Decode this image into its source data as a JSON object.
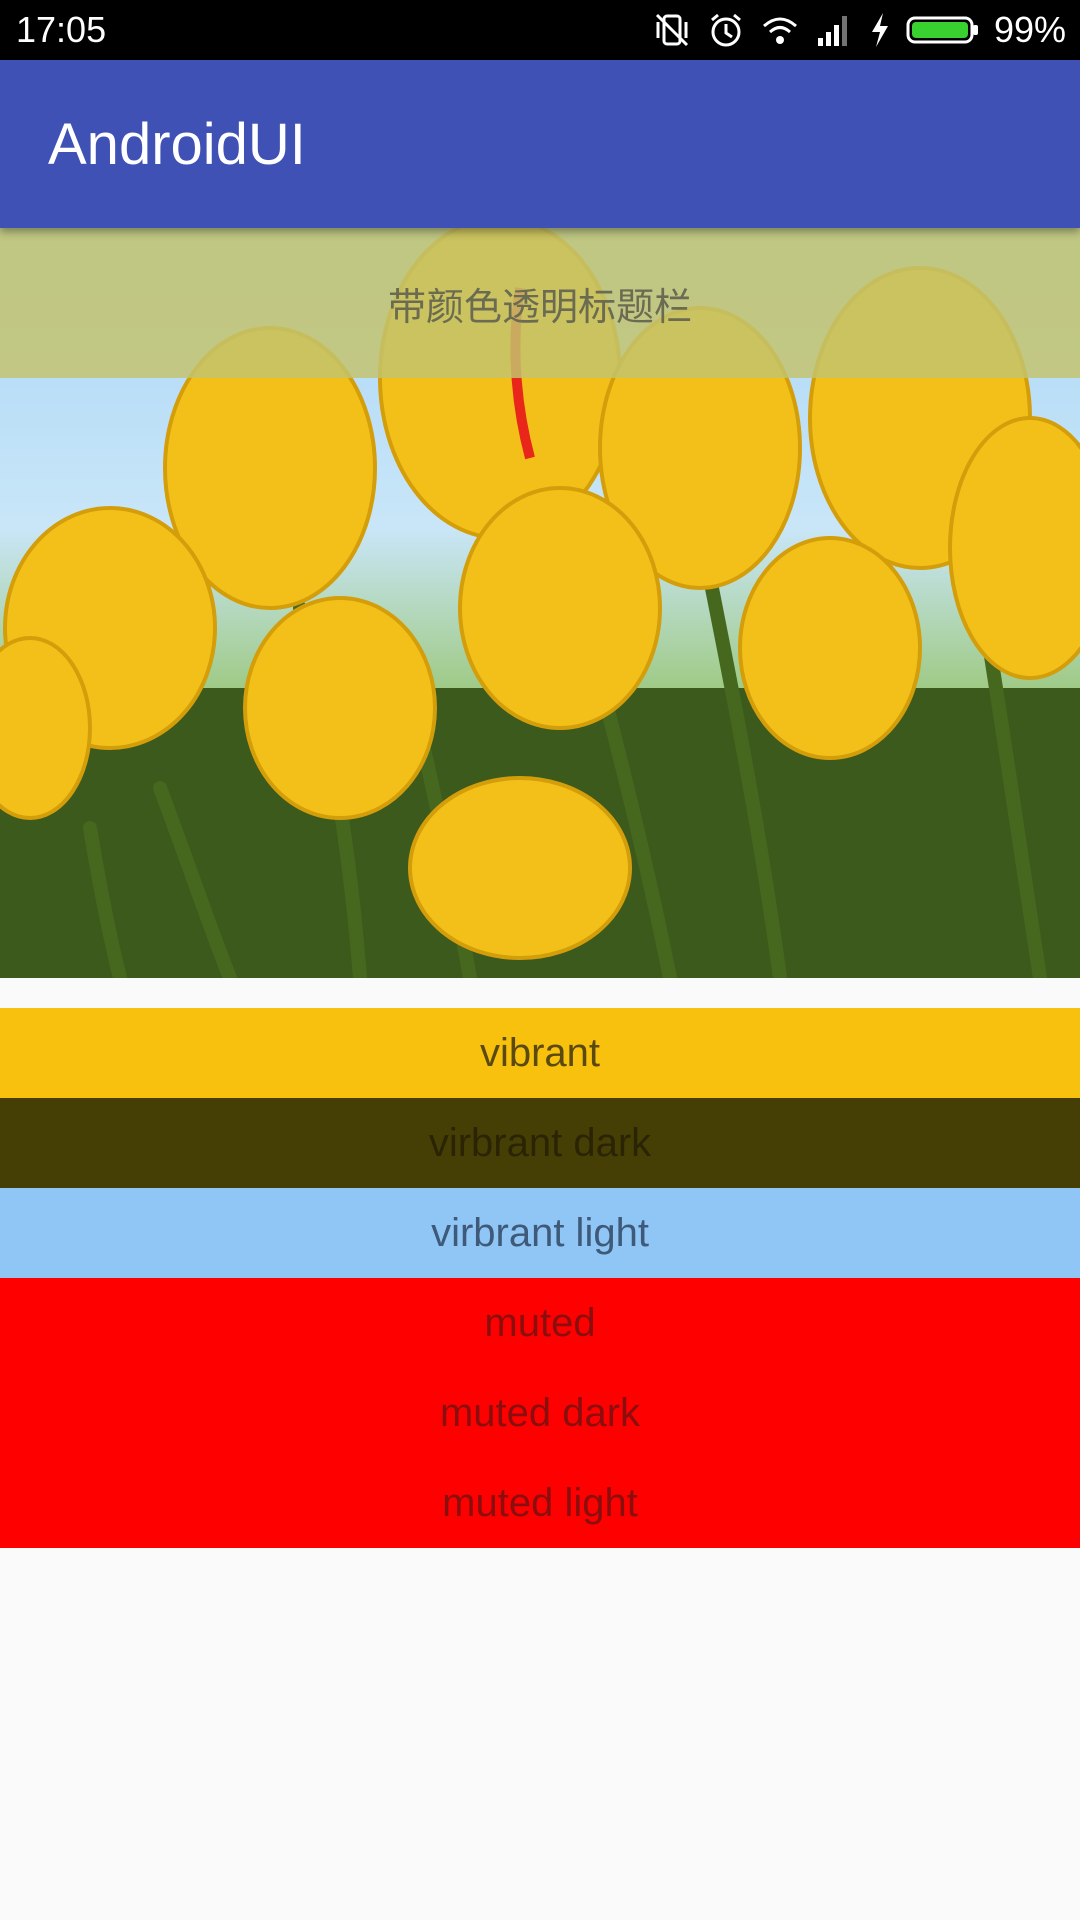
{
  "status_bar": {
    "time": "17:05",
    "battery_percent": "99%",
    "icons": [
      "vibrate-off-icon",
      "alarm-icon",
      "wifi-icon",
      "signal-icon",
      "charging-icon",
      "battery-icon"
    ]
  },
  "app_bar": {
    "title": "AndroidUI"
  },
  "header_image": {
    "overlay_title": "带颜色透明标题栏",
    "overlay_color": "#c4c46c",
    "image_subject": "yellow-tulips-photo"
  },
  "palette": [
    {
      "label": "vibrant",
      "background": "#f7c10d",
      "text_color": "#5b4a10"
    },
    {
      "label": "virbrant dark",
      "background": "#463f05",
      "text_color": "#2a2404"
    },
    {
      "label": "virbrant light",
      "background": "#90c6f6",
      "text_color": "#3e5a78"
    },
    {
      "label": "muted",
      "background": "#ff0000",
      "text_color": "#8a0e0e"
    },
    {
      "label": "muted dark",
      "background": "#ff0000",
      "text_color": "#8a0e0e"
    },
    {
      "label": "muted light",
      "background": "#ff0000",
      "text_color": "#8a0e0e"
    }
  ]
}
